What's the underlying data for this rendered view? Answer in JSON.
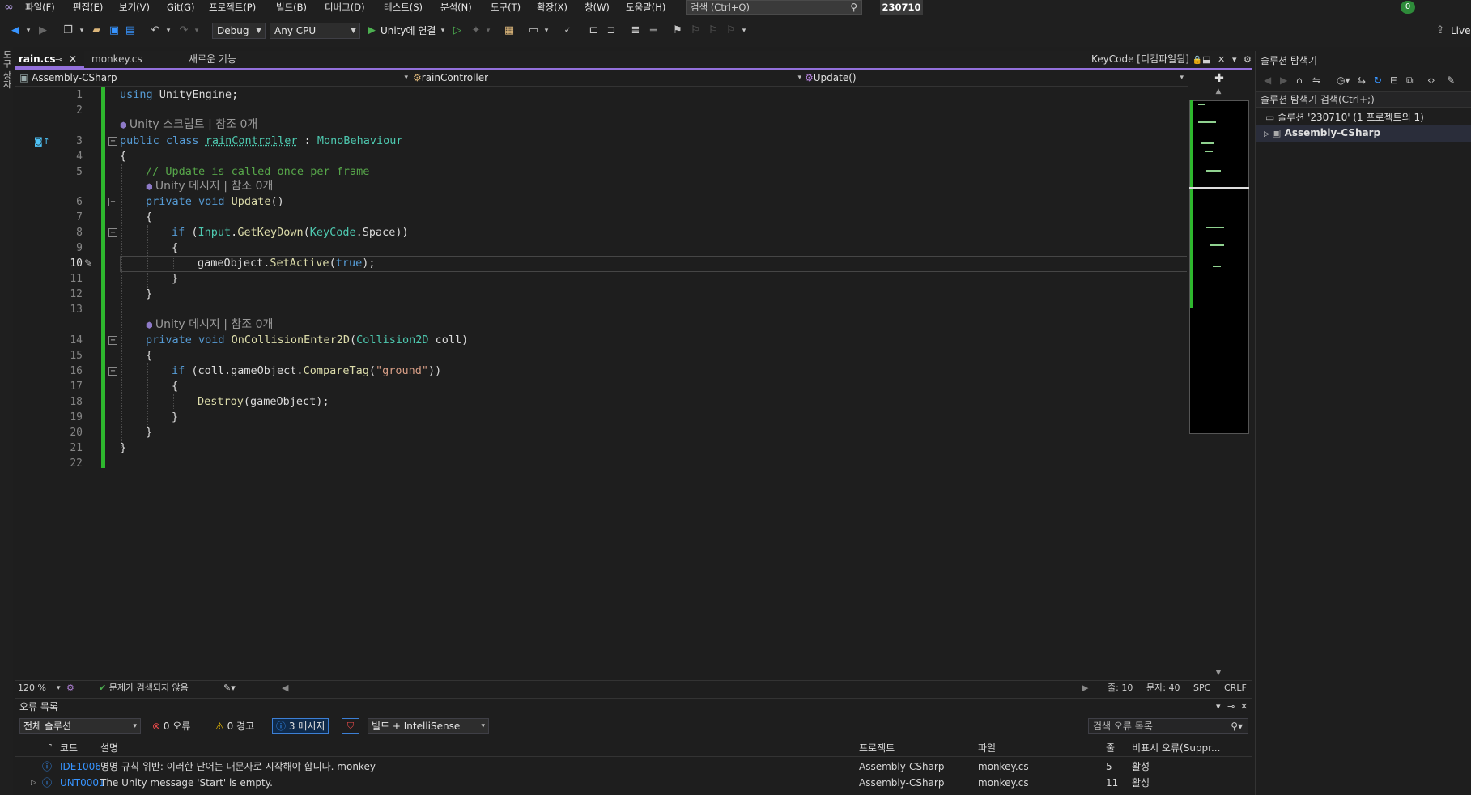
{
  "menu": {
    "items": [
      "파일(F)",
      "편집(E)",
      "보기(V)",
      "Git(G)",
      "프로젝트(P)",
      "빌드(B)",
      "디버그(D)",
      "테스트(S)",
      "분석(N)",
      "도구(T)",
      "확장(X)",
      "창(W)",
      "도움말(H)"
    ],
    "search_placeholder": "검색 (Ctrl+Q)",
    "solution_name": "230710",
    "notification_count": "0"
  },
  "toolbar": {
    "config": "Debug",
    "platform": "Any CPU",
    "run_label": "Unity에 연결",
    "live_label": "Live"
  },
  "left_strip": {
    "label": "도구 상자"
  },
  "tabs": {
    "active": "rain.cs",
    "second": "monkey.cs",
    "third": "새로운 기능",
    "preview": "KeyCode [디컴파일됨]"
  },
  "navbar": {
    "project": "Assembly-CSharp",
    "type": "rainController",
    "member": "Update()"
  },
  "editor": {
    "line_numbers": [
      "1",
      "2",
      "3",
      "4",
      "5",
      "6",
      "7",
      "8",
      "9",
      "10",
      "11",
      "12",
      "13",
      "14",
      "15",
      "16",
      "17",
      "18",
      "19",
      "20",
      "21",
      "22"
    ],
    "lens_script": "Unity 스크립트 | 참조 0개",
    "lens_message_1": "Unity 메시지 | 참조 0개",
    "lens_message_2": "Unity 메시지 | 참조 0개",
    "code": {
      "l1_kw": "using",
      "l1_rest": " UnityEngine;",
      "l3_kw": "public class",
      "l3_name": "rainController",
      "l3_sep": " : ",
      "l3_base": "MonoBehaviour",
      "l4": "{",
      "l5": "// Update is called once per frame",
      "l6_kw": "private void",
      "l6_fn": " Update",
      "l6_rest": "()",
      "l7": "{",
      "l8_kw": "if",
      "l8_p": " (",
      "l8_ty": "Input",
      "l8_dot": ".",
      "l8_fn": "GetKeyDown",
      "l8_p2": "(",
      "l8_ty2": "KeyCode",
      "l8_rest": ".Space))",
      "l9": "{",
      "l10_a": "gameObject.",
      "l10_fn": "SetActive",
      "l10_p": "(",
      "l10_kw": "true",
      "l10_rest": ");",
      "l11": "}",
      "l12": "}",
      "l14_kw": "private void",
      "l14_fn": " OnCollisionEnter2D",
      "l14_p": "(",
      "l14_ty": "Collision2D",
      "l14_rest": " coll)",
      "l15": "{",
      "l16_kw": "if",
      "l16_a": " (coll.gameObject.",
      "l16_fn": "CompareTag",
      "l16_p": "(",
      "l16_st": "\"ground\"",
      "l16_rest": "))",
      "l17": "{",
      "l18_fn": "Destroy",
      "l18_rest": "(gameObject);",
      "l19": "}",
      "l20": "}",
      "l21": "}"
    }
  },
  "editor_status": {
    "zoom": "120 %",
    "issues": "문제가 검색되지 않음",
    "line": "줄: 10",
    "char": "문자: 40",
    "spc": "SPC",
    "crlf": "CRLF"
  },
  "error_list": {
    "title": "오류 목록",
    "scope": "전체 솔루션",
    "errors": "0 오류",
    "warnings": "0 경고",
    "messages": "3 메시지",
    "build_filter": "빌드 + IntelliSense",
    "search_placeholder": "검색 오류 목록",
    "columns": {
      "code": "코드",
      "description": "설명",
      "project": "프로젝트",
      "file": "파일",
      "line": "줄",
      "suppression": "비표시 오류(Suppr..."
    },
    "rows": [
      {
        "code": "IDE1006",
        "description": "명명 규칙 위반: 이러한 단어는 대문자로 시작해야 합니다. monkey",
        "project": "Assembly-CSharp",
        "file": "monkey.cs",
        "line": "5",
        "status": "활성"
      },
      {
        "code": "UNT0001",
        "description": "The Unity message 'Start' is empty.",
        "project": "Assembly-CSharp",
        "file": "monkey.cs",
        "line": "11",
        "status": "활성"
      }
    ]
  },
  "solution_explorer": {
    "title": "솔루션 탐색기",
    "search_placeholder": "솔루션 탐색기 검색(Ctrl+;)",
    "solution_node": "솔루션 '230710' (1 프로젝트의 1)",
    "project_node": "Assembly-CSharp"
  }
}
